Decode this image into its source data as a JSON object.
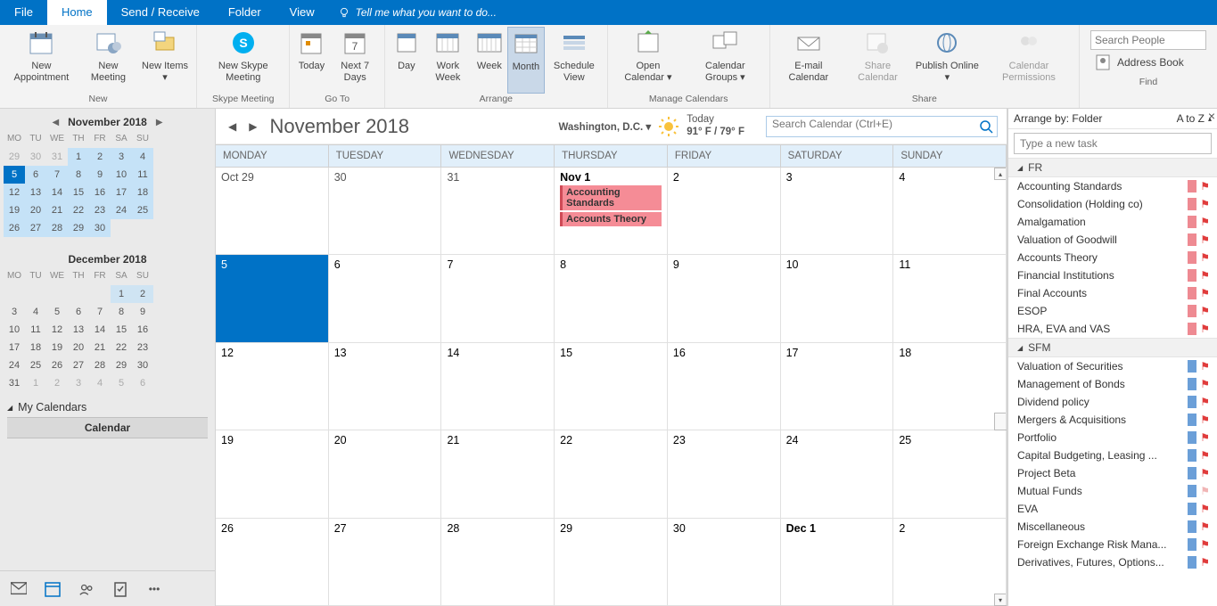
{
  "menu": {
    "file": "File",
    "home": "Home",
    "sendrecv": "Send / Receive",
    "folder": "Folder",
    "view": "View",
    "help": "Tell me what you want to do..."
  },
  "ribbon": {
    "new_appt": "New\nAppointment",
    "new_mtg": "New\nMeeting",
    "new_items": "New\nItems ▾",
    "new_group": "New",
    "skype": "New Skype\nMeeting",
    "skype_group": "Skype Meeting",
    "today": "Today",
    "next7": "Next 7\nDays",
    "goto_group": "Go To",
    "day": "Day",
    "wweek": "Work\nWeek",
    "week": "Week",
    "month": "Month",
    "sched": "Schedule\nView",
    "arrange_group": "Arrange",
    "opencal": "Open\nCalendar ▾",
    "calgroups": "Calendar\nGroups ▾",
    "managecal_group": "Manage Calendars",
    "email": "E-mail\nCalendar",
    "share": "Share\nCalendar",
    "publish": "Publish\nOnline ▾",
    "perms": "Calendar\nPermissions",
    "share_group": "Share",
    "search_people": "Search People",
    "addr": "Address Book",
    "find_group": "Find"
  },
  "nav": {
    "month1": "November 2018",
    "month2": "December 2018",
    "dow": [
      "MO",
      "TU",
      "WE",
      "TH",
      "FR",
      "SA",
      "SU"
    ],
    "m1_weeks": [
      [
        {
          "n": "29",
          "o": 1
        },
        {
          "n": "30",
          "o": 1
        },
        {
          "n": "31",
          "o": 1
        },
        {
          "n": "1",
          "hl": 1
        },
        {
          "n": "2",
          "hl": 1
        },
        {
          "n": "3",
          "hl": 1
        },
        {
          "n": "4",
          "hl": 1
        }
      ],
      [
        {
          "n": "5",
          "today": 1
        },
        {
          "n": "6",
          "hl": 1
        },
        {
          "n": "7",
          "hl": 1
        },
        {
          "n": "8",
          "hl": 1
        },
        {
          "n": "9",
          "hl": 1
        },
        {
          "n": "10",
          "hl": 1
        },
        {
          "n": "11",
          "hl": 1
        }
      ],
      [
        {
          "n": "12",
          "hl": 1
        },
        {
          "n": "13",
          "hl": 1
        },
        {
          "n": "14",
          "hl": 1
        },
        {
          "n": "15",
          "hl": 1
        },
        {
          "n": "16",
          "hl": 1
        },
        {
          "n": "17",
          "hl": 1
        },
        {
          "n": "18",
          "hl": 1
        }
      ],
      [
        {
          "n": "19",
          "hl": 1
        },
        {
          "n": "20",
          "hl": 1
        },
        {
          "n": "21",
          "hl": 1
        },
        {
          "n": "22",
          "hl": 1
        },
        {
          "n": "23",
          "hl": 1
        },
        {
          "n": "24",
          "hl": 1
        },
        {
          "n": "25",
          "hl": 1
        }
      ],
      [
        {
          "n": "26",
          "hl": 1
        },
        {
          "n": "27",
          "hl": 1
        },
        {
          "n": "28",
          "hl": 1
        },
        {
          "n": "29",
          "hl": 1
        },
        {
          "n": "30",
          "hl": 1
        },
        {
          "n": "",
          "o": 1
        },
        {
          "n": "",
          "o": 1
        }
      ]
    ],
    "m2_weeks": [
      [
        {
          "n": ""
        },
        {
          "n": ""
        },
        {
          "n": ""
        },
        {
          "n": ""
        },
        {
          "n": ""
        },
        {
          "n": "1",
          "sel": 1
        },
        {
          "n": "2",
          "sel": 1
        }
      ],
      [
        {
          "n": "3"
        },
        {
          "n": "4"
        },
        {
          "n": "5"
        },
        {
          "n": "6"
        },
        {
          "n": "7"
        },
        {
          "n": "8"
        },
        {
          "n": "9"
        }
      ],
      [
        {
          "n": "10"
        },
        {
          "n": "11"
        },
        {
          "n": "12"
        },
        {
          "n": "13"
        },
        {
          "n": "14"
        },
        {
          "n": "15"
        },
        {
          "n": "16"
        }
      ],
      [
        {
          "n": "17"
        },
        {
          "n": "18"
        },
        {
          "n": "19"
        },
        {
          "n": "20"
        },
        {
          "n": "21"
        },
        {
          "n": "22"
        },
        {
          "n": "23"
        }
      ],
      [
        {
          "n": "24"
        },
        {
          "n": "25"
        },
        {
          "n": "26"
        },
        {
          "n": "27"
        },
        {
          "n": "28"
        },
        {
          "n": "29"
        },
        {
          "n": "30"
        }
      ],
      [
        {
          "n": "31"
        },
        {
          "n": "1",
          "o": 1
        },
        {
          "n": "2",
          "o": 1
        },
        {
          "n": "3",
          "o": 1
        },
        {
          "n": "4",
          "o": 1
        },
        {
          "n": "5",
          "o": 1
        },
        {
          "n": "6",
          "o": 1
        }
      ]
    ],
    "my_cals": "My Calendars",
    "cal_item": "Calendar"
  },
  "cal": {
    "title": "November 2018",
    "loc": "Washington,  D.C.",
    "today_label": "Today",
    "temp": "91° F / 79° F",
    "search_ph": "Search Calendar (Ctrl+E)",
    "dow": [
      "MONDAY",
      "TUESDAY",
      "WEDNESDAY",
      "THURSDAY",
      "FRIDAY",
      "SATURDAY",
      "SUNDAY"
    ],
    "weeks": [
      [
        {
          "n": "Oct 29",
          "other": 1
        },
        {
          "n": "30",
          "other": 1
        },
        {
          "n": "31",
          "other": 1
        },
        {
          "n": "Nov 1",
          "bold": 1,
          "events": [
            "Accounting Standards",
            "Accounts Theory"
          ]
        },
        {
          "n": "2"
        },
        {
          "n": "3"
        },
        {
          "n": "4"
        }
      ],
      [
        {
          "n": "5",
          "selected": 1
        },
        {
          "n": "6"
        },
        {
          "n": "7"
        },
        {
          "n": "8"
        },
        {
          "n": "9"
        },
        {
          "n": "10"
        },
        {
          "n": "11"
        }
      ],
      [
        {
          "n": "12"
        },
        {
          "n": "13"
        },
        {
          "n": "14"
        },
        {
          "n": "15"
        },
        {
          "n": "16"
        },
        {
          "n": "17"
        },
        {
          "n": "18"
        }
      ],
      [
        {
          "n": "19"
        },
        {
          "n": "20"
        },
        {
          "n": "21"
        },
        {
          "n": "22"
        },
        {
          "n": "23"
        },
        {
          "n": "24"
        },
        {
          "n": "25"
        }
      ],
      [
        {
          "n": "26"
        },
        {
          "n": "27"
        },
        {
          "n": "28"
        },
        {
          "n": "29"
        },
        {
          "n": "30"
        },
        {
          "n": "Dec 1",
          "bold": 1
        },
        {
          "n": "2"
        }
      ]
    ]
  },
  "tasks": {
    "arrange": "Arrange by: Folder",
    "sort": "A to Z",
    "new_ph": "Type a new task",
    "groups": [
      {
        "name": "FR",
        "color": "#ee8a92",
        "items": [
          {
            "t": "Accounting Standards"
          },
          {
            "t": "Consolidation (Holding co)"
          },
          {
            "t": "Amalgamation"
          },
          {
            "t": "Valuation of Goodwill"
          },
          {
            "t": "Accounts Theory"
          },
          {
            "t": "Financial Institutions"
          },
          {
            "t": "Final Accounts"
          },
          {
            "t": "ESOP"
          },
          {
            "t": "HRA, EVA and VAS"
          }
        ]
      },
      {
        "name": "SFM",
        "color": "#6b9fd8",
        "items": [
          {
            "t": "Valuation of Securities"
          },
          {
            "t": "Management of Bonds"
          },
          {
            "t": "Dividend policy"
          },
          {
            "t": "Mergers & Acquisitions"
          },
          {
            "t": "Portfolio"
          },
          {
            "t": "Capital Budgeting, Leasing ..."
          },
          {
            "t": "Project Beta"
          },
          {
            "t": "Mutual Funds",
            "faded": 1
          },
          {
            "t": "EVA"
          },
          {
            "t": "Miscellaneous"
          },
          {
            "t": "Foreign Exchange Risk Mana..."
          },
          {
            "t": "Derivatives, Futures, Options..."
          }
        ]
      }
    ]
  }
}
